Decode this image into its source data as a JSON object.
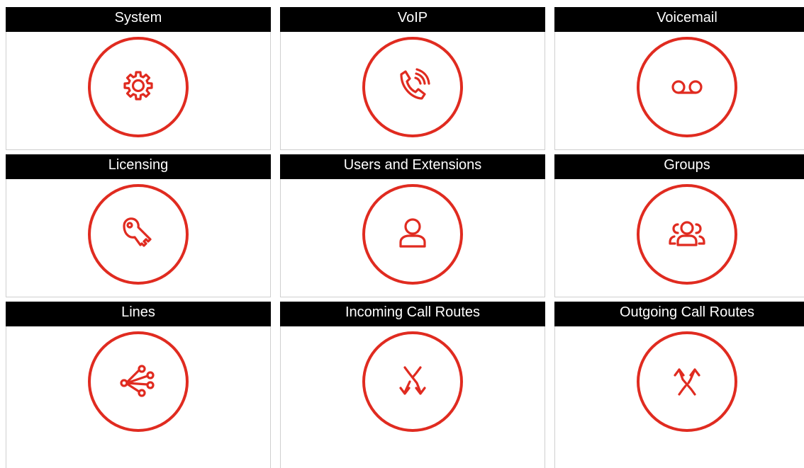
{
  "accent_color": "#e02b20",
  "header_color": "#000000",
  "tiles": [
    {
      "label": "System",
      "icon": "gear-icon"
    },
    {
      "label": "VoIP",
      "icon": "phone-call-icon"
    },
    {
      "label": "Voicemail",
      "icon": "voicemail-icon"
    },
    {
      "label": "Licensing",
      "icon": "key-icon"
    },
    {
      "label": "Users and Extensions",
      "icon": "user-icon"
    },
    {
      "label": "Groups",
      "icon": "users-group-icon"
    },
    {
      "label": "Lines",
      "icon": "lines-icon"
    },
    {
      "label": "Incoming Call Routes",
      "icon": "incoming-routes-icon"
    },
    {
      "label": "Outgoing Call Routes",
      "icon": "outgoing-routes-icon"
    }
  ]
}
